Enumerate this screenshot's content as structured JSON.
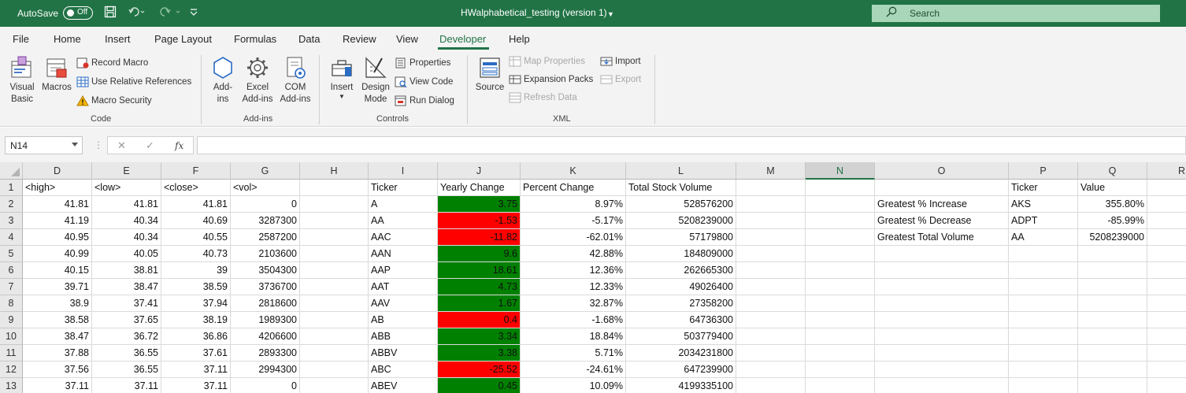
{
  "titlebar": {
    "autosave_label": "AutoSave",
    "autosave_state": "Off",
    "doc_title": "HWalphabetical_testing (version 1)",
    "search_placeholder": "Search",
    "accent": "#217346"
  },
  "menu_tabs": [
    "File",
    "Home",
    "Insert",
    "Page Layout",
    "Formulas",
    "Data",
    "Review",
    "View",
    "Developer",
    "Help"
  ],
  "active_tab": "Developer",
  "ribbon": {
    "code": {
      "label": "Code",
      "visual_basic": "Visual Basic",
      "macros": "Macros",
      "record_macro": "Record Macro",
      "use_relative": "Use Relative References",
      "macro_security": "Macro Security"
    },
    "addins": {
      "label": "Add-ins",
      "addins_btn": "Add-ins",
      "excel_addins": "Excel Add-ins",
      "com_addins": "COM Add-ins"
    },
    "controls": {
      "label": "Controls",
      "insert": "Insert",
      "design_mode": "Design Mode",
      "properties": "Properties",
      "view_code": "View Code",
      "run_dialog": "Run Dialog"
    },
    "xml": {
      "label": "XML",
      "source": "Source",
      "map_properties": "Map Properties",
      "expansion_packs": "Expansion Packs",
      "refresh_data": "Refresh Data",
      "import": "Import",
      "export": "Export"
    }
  },
  "formula_bar": {
    "name_box": "N14",
    "fx": "fx",
    "formula": ""
  },
  "columns": [
    "D",
    "E",
    "F",
    "G",
    "H",
    "I",
    "J",
    "K",
    "L",
    "M",
    "N",
    "O",
    "P",
    "Q",
    "R"
  ],
  "selected_column": "N",
  "row_numbers": [
    "1",
    "2",
    "3",
    "4",
    "5",
    "6",
    "7",
    "8",
    "9",
    "10",
    "11",
    "12",
    "13"
  ],
  "headers": {
    "D": "<high>",
    "E": "<low>",
    "F": "<close>",
    "G": "<vol>",
    "I": "Ticker",
    "J": "Yearly Change",
    "K": "Percent Change",
    "L": "Total Stock Volume",
    "P": "Ticker",
    "Q": "Value"
  },
  "rows": [
    {
      "high": "41.81",
      "low": "41.81",
      "close": "41.81",
      "vol": "0",
      "ticker": "A",
      "change": "3.75",
      "pct": "8.97%",
      "total": "528576200"
    },
    {
      "high": "41.19",
      "low": "40.34",
      "close": "40.69",
      "vol": "3287300",
      "ticker": "AA",
      "change": "-1.53",
      "pct": "-5.17%",
      "total": "5208239000"
    },
    {
      "high": "40.95",
      "low": "40.34",
      "close": "40.55",
      "vol": "2587200",
      "ticker": "AAC",
      "change": "-11.82",
      "pct": "-62.01%",
      "total": "57179800"
    },
    {
      "high": "40.99",
      "low": "40.05",
      "close": "40.73",
      "vol": "2103600",
      "ticker": "AAN",
      "change": "9.6",
      "pct": "42.88%",
      "total": "184809000"
    },
    {
      "high": "40.15",
      "low": "38.81",
      "close": "39",
      "vol": "3504300",
      "ticker": "AAP",
      "change": "18.61",
      "pct": "12.36%",
      "total": "262665300"
    },
    {
      "high": "39.71",
      "low": "38.47",
      "close": "38.59",
      "vol": "3736700",
      "ticker": "AAT",
      "change": "4.73",
      "pct": "12.33%",
      "total": "49026400"
    },
    {
      "high": "38.9",
      "low": "37.41",
      "close": "37.94",
      "vol": "2818600",
      "ticker": "AAV",
      "change": "1.67",
      "pct": "32.87%",
      "total": "27358200"
    },
    {
      "high": "38.58",
      "low": "37.65",
      "close": "38.19",
      "vol": "1989300",
      "ticker": "AB",
      "change": "0.4",
      "pct": "-1.68%",
      "total": "64736300"
    },
    {
      "high": "38.47",
      "low": "36.72",
      "close": "36.86",
      "vol": "4206600",
      "ticker": "ABB",
      "change": "3.34",
      "pct": "18.84%",
      "total": "503779400"
    },
    {
      "high": "37.88",
      "low": "36.55",
      "close": "37.61",
      "vol": "2893300",
      "ticker": "ABBV",
      "change": "3.38",
      "pct": "5.71%",
      "total": "2034231800"
    },
    {
      "high": "37.56",
      "low": "36.55",
      "close": "37.11",
      "vol": "2994300",
      "ticker": "ABC",
      "change": "-25.52",
      "pct": "-24.61%",
      "total": "647239900"
    },
    {
      "high": "37.11",
      "low": "37.11",
      "close": "37.11",
      "vol": "0",
      "ticker": "ABEV",
      "change": "0.45",
      "pct": "10.09%",
      "total": "4199335100"
    }
  ],
  "change_colors": [
    "green",
    "red",
    "red",
    "green",
    "green",
    "green",
    "green",
    "red",
    "green",
    "green",
    "red",
    "green"
  ],
  "colors": {
    "positive": "#008000",
    "negative": "#ff0000"
  },
  "summary": [
    {
      "label": "Greatest % Increase",
      "ticker": "AKS",
      "value": "355.80%"
    },
    {
      "label": "Greatest % Decrease",
      "ticker": "ADPT",
      "value": "-85.99%"
    },
    {
      "label": "Greatest Total Volume",
      "ticker": "AA",
      "value": "5208239000"
    }
  ]
}
